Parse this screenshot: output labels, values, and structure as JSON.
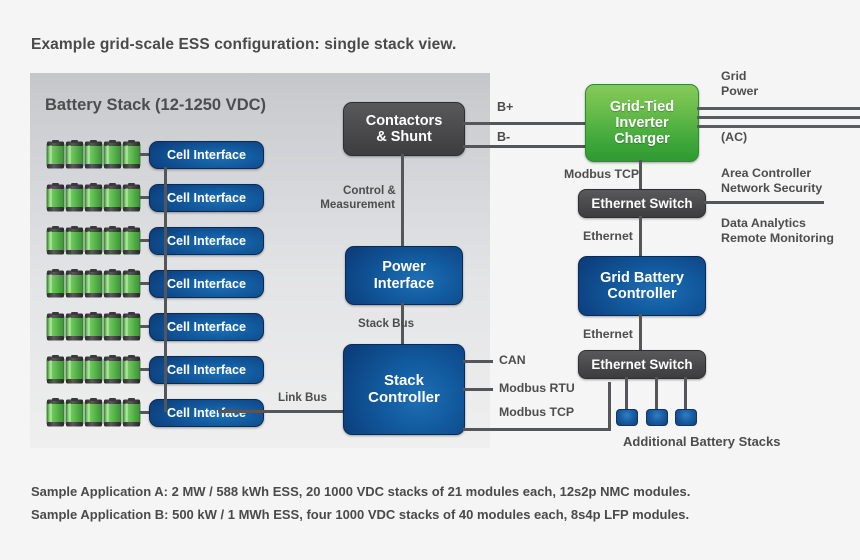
{
  "title": "Example grid-scale ESS configuration: single stack view.",
  "panel": {
    "heading": "Battery Stack (12-1250 VDC)",
    "cell_interface_label": "Cell Interface",
    "rows": 7
  },
  "nodes": {
    "contactors": "Contactors\n& Shunt",
    "contactors_line1": "Contactors",
    "contactors_line2": "& Shunt",
    "power_interface_line1": "Power",
    "power_interface_line2": "Interface",
    "stack_controller_line1": "Stack",
    "stack_controller_line2": "Controller",
    "inverter_line1": "Grid-Tied",
    "inverter_line2": "Inverter",
    "inverter_line3": "Charger",
    "ethernet_switch_top": "Ethernet Switch",
    "ethernet_switch_bottom": "Ethernet Switch",
    "grid_battery_controller_line1": "Grid Battery",
    "grid_battery_controller_line2": "Controller"
  },
  "labels": {
    "control_measurement_line1": "Control &",
    "control_measurement_line2": "Measurement",
    "stack_bus": "Stack Bus",
    "link_bus": "Link Bus",
    "b_plus": "B+",
    "b_minus": "B-",
    "can": "CAN",
    "modbus_rtu": "Modbus RTU",
    "modbus_tcp_stack": "Modbus TCP",
    "modbus_tcp_inverter": "Modbus TCP",
    "ethernet_upper": "Ethernet",
    "ethernet_lower": "Ethernet",
    "grid_power_line1": "Grid",
    "grid_power_line2": "Power",
    "ac": "(AC)",
    "area_controller_line1": "Area Controller",
    "area_controller_line2": "Network Security",
    "data_analytics_line1": "Data Analytics",
    "data_analytics_line2": "Remote Monitoring",
    "additional_stacks": "Additional Battery Stacks"
  },
  "footer": {
    "line_a": "Sample Application A: 2 MW / 588 kWh ESS, 20 1000 VDC stacks of 21 modules each, 12s2p NMC modules.",
    "line_b": "Sample Application B: 500 kW / 1 MWh ESS, four 1000 VDC stacks of 40 modules each, 8s4p LFP modules."
  },
  "colors": {
    "blue": "#0c3f7d",
    "gray": "#4c4c4e",
    "green": "#41a93b",
    "battery_green": "#5fbb52",
    "page_background": "#f5f5f5",
    "panel_background": "#d9dadc",
    "text": "#4d4d4d"
  }
}
